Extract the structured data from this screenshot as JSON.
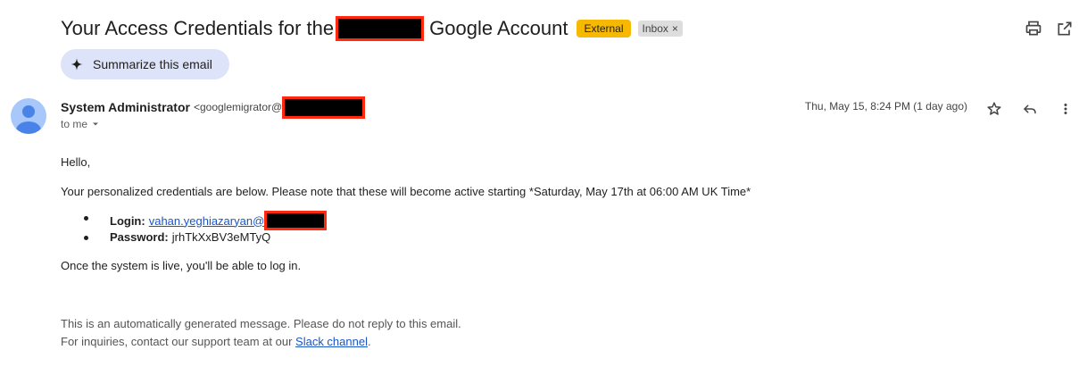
{
  "subject": {
    "prefix": "Your Access Credentials for the",
    "suffix": "Google Account",
    "external_badge": "External",
    "inbox_badge": "Inbox",
    "inbox_badge_close": "×"
  },
  "summarize": {
    "label": "Summarize this email"
  },
  "sender": {
    "name": "System Administrator",
    "email_prefix": "<googlemigrator@",
    "to": "to me",
    "date": "Thu, May 15, 8:24 PM (1 day ago)"
  },
  "body": {
    "greeting": "Hello,",
    "intro": "Your personalized credentials are below. Please note that these will become active starting *Saturday, May 17th at 06:00 AM UK Time*",
    "login_label": "Login:",
    "login_value": "vahan.yeghiazaryan@",
    "password_label": "Password:",
    "password_value": "jrhTkXxBV3eMTyQ",
    "outro": "Once the system is live, you'll be able to log in.",
    "footer_1": "This is an automatically generated message. Please do not reply to this email.",
    "footer_2_prefix": "For inquiries, contact our support team at our",
    "footer_2_link": "Slack channel",
    "footer_2_suffix": "."
  },
  "icons": [
    "sparkle-icon",
    "print-icon",
    "open-in-new-window-icon",
    "avatar-person-icon",
    "chevron-down-icon",
    "star-icon",
    "reply-icon",
    "more-vert-icon"
  ],
  "colors": {
    "external_badge": "#f6b800",
    "summarize_bg": "#dde3f8",
    "avatar_bg": "#a8c7fa",
    "link": "#1a55c4",
    "redaction_border": "#ff2a10"
  }
}
